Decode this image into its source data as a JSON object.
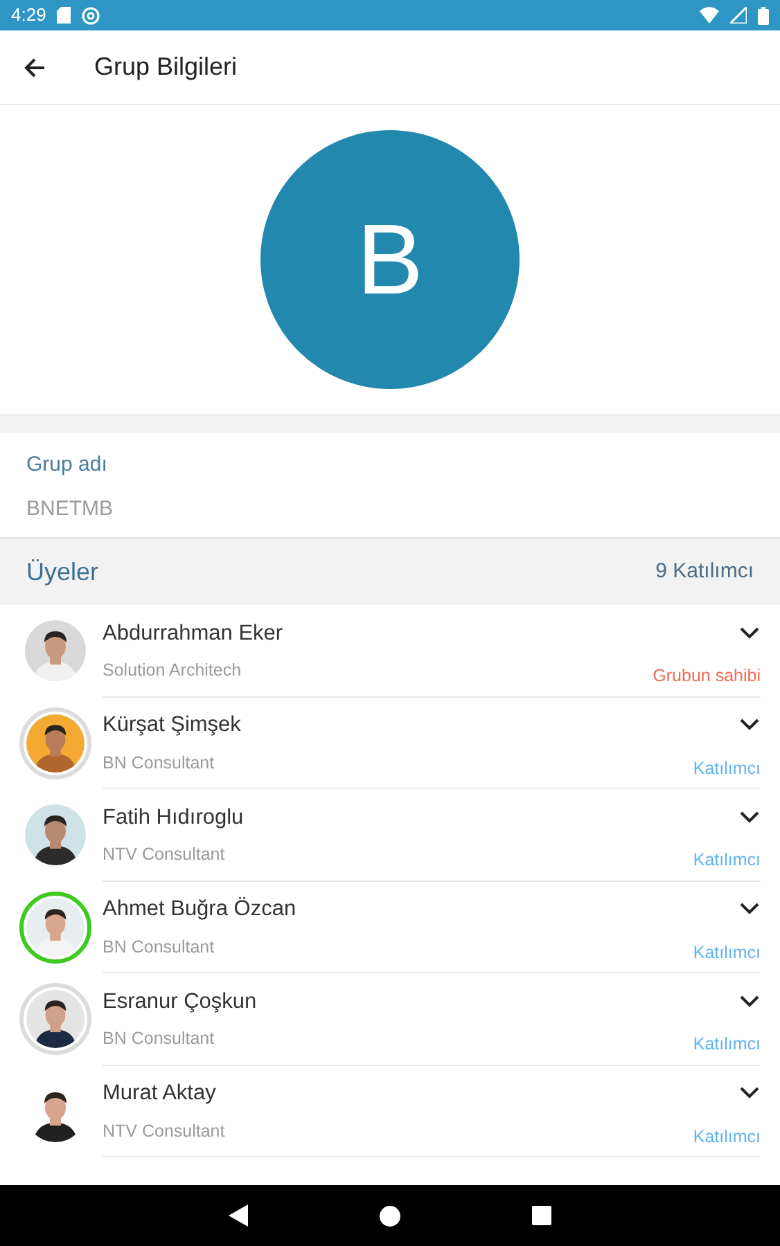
{
  "status_bar": {
    "time": "4:29"
  },
  "toolbar": {
    "title": "Grup Bilgileri"
  },
  "group_avatar": {
    "letter": "B"
  },
  "group_name": {
    "label": "Grup adı",
    "value": "BNETMB"
  },
  "members_header": {
    "title": "Üyeler",
    "count": "9 Katılımcı"
  },
  "members": [
    {
      "name": "Abdurrahman Eker",
      "title": "Solution Architech",
      "role": "Grubun sahibi",
      "kind": "owner",
      "ring": false
    },
    {
      "name": "Kürşat Şimşek",
      "title": "BN Consultant",
      "role": "Katılımcı",
      "kind": "member",
      "ring": true,
      "color": "#dcdcdc"
    },
    {
      "name": "Fatih Hıdıroglu",
      "title": "NTV Consultant",
      "role": "Katılımcı",
      "kind": "member",
      "ring": false
    },
    {
      "name": "Ahmet Buğra Özcan",
      "title": "BN Consultant",
      "role": "Katılımcı",
      "kind": "member",
      "ring": true,
      "color": "#3ecb1f"
    },
    {
      "name": "Esranur Çoşkun",
      "title": "BN Consultant",
      "role": "Katılımcı",
      "kind": "member",
      "ring": true,
      "color": "#dcdcdc"
    },
    {
      "name": "Murat Aktay",
      "title": "NTV Consultant",
      "role": "Katılımcı",
      "kind": "member",
      "ring": false
    }
  ]
}
